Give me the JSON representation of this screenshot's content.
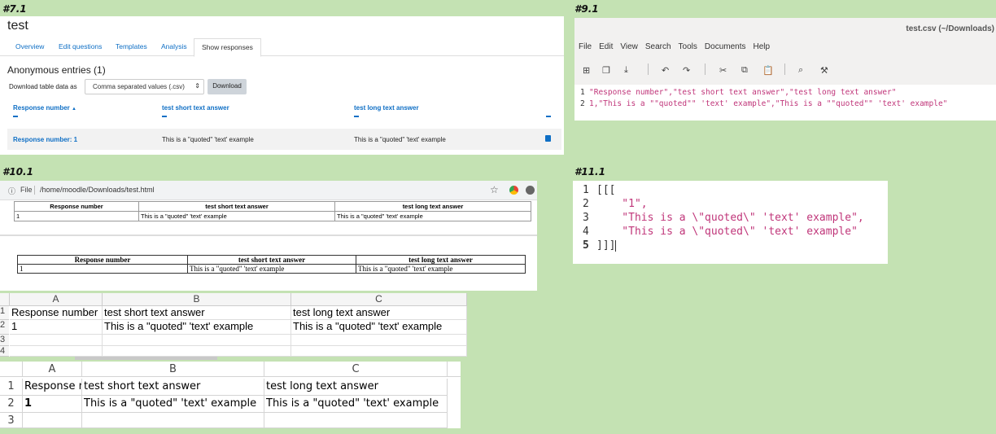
{
  "labels": {
    "p71": "#7.1",
    "p91": "#9.1",
    "p101": "#10.1",
    "p111": "#11.1"
  },
  "moodle": {
    "title": "test",
    "tabs": [
      "Overview",
      "Edit questions",
      "Templates",
      "Analysis",
      "Show responses"
    ],
    "active_tab": "Show responses",
    "heading": "Anonymous entries (1)",
    "download_label": "Download table data as",
    "format_select": "Comma separated values (.csv)",
    "download_button": "Download",
    "columns": [
      "Response number",
      "test short text answer",
      "test long text answer"
    ],
    "sort_indicator": "▲",
    "row": [
      "Response number: 1",
      "This is a \"quoted\" 'text' example",
      "This is a \"quoted\" 'text' example"
    ]
  },
  "editor": {
    "window_title": "test.csv (~/Downloads)",
    "menu": [
      "File",
      "Edit",
      "View",
      "Search",
      "Tools",
      "Documents",
      "Help"
    ],
    "lines": [
      {
        "n": "1",
        "text": "\"Response number\",\"test short text answer\",\"test long text answer\""
      },
      {
        "n": "2",
        "text": "1,\"This is a \"\"quoted\"\" 'text' example\",\"This is a \"\"quoted\"\" 'text' example\""
      }
    ]
  },
  "browser": {
    "info_icon": "ⓘ",
    "file_label": "File",
    "url": "/home/moodle/Downloads/test.html",
    "headers": [
      "Response number",
      "test short text answer",
      "test long text answer"
    ],
    "row": [
      "1",
      "This is a \"quoted\" 'text' example",
      "This is a \"quoted\" 'text' example"
    ]
  },
  "json_view": {
    "lines": [
      {
        "n": "1",
        "text": "[[["
      },
      {
        "n": "2",
        "text": "    \"1\","
      },
      {
        "n": "3",
        "text": "    \"This is a \\\"quoted\\\" 'text' example\","
      },
      {
        "n": "4",
        "text": "    \"This is a \\\"quoted\\\" 'text' example\""
      },
      {
        "n": "5",
        "text": "]]]"
      }
    ]
  },
  "sheet1": {
    "cols": [
      "A",
      "B",
      "C"
    ],
    "rows": [
      {
        "n": "1",
        "cells": [
          "Response number",
          "test short text answer",
          "test long text answer"
        ]
      },
      {
        "n": "2",
        "cells": [
          "1",
          "This is a \"quoted\" 'text' example",
          "This is a \"quoted\" 'text' example"
        ]
      },
      {
        "n": "3",
        "cells": [
          "",
          "",
          ""
        ]
      },
      {
        "n": "4",
        "cells": [
          "",
          "",
          ""
        ]
      }
    ]
  },
  "sheet2": {
    "cols": [
      "A",
      "B",
      "C"
    ],
    "rows": [
      {
        "n": "1",
        "cells": [
          "Response number",
          "test short text answer",
          "test long text answer"
        ]
      },
      {
        "n": "2",
        "cells": [
          "1",
          "This is a \"quoted\" 'text' example",
          "This is a \"quoted\" 'text' example"
        ]
      },
      {
        "n": "3",
        "cells": [
          "",
          "",
          ""
        ]
      }
    ]
  }
}
